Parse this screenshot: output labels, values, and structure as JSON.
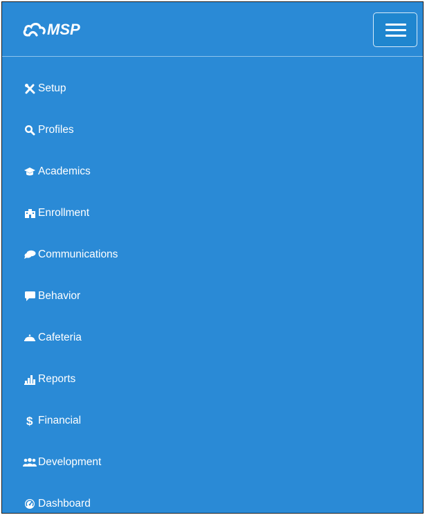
{
  "header": {
    "logo_text": "MSP",
    "menu_toggle_icon": "hamburger-icon"
  },
  "nav": {
    "items": [
      {
        "label": "Setup",
        "icon": "tools-icon"
      },
      {
        "label": "Profiles",
        "icon": "search-icon"
      },
      {
        "label": "Academics",
        "icon": "graduation-cap-icon"
      },
      {
        "label": "Enrollment",
        "icon": "building-icon"
      },
      {
        "label": "Communications",
        "icon": "chat-bubbles-icon"
      },
      {
        "label": "Behavior",
        "icon": "comment-icon"
      },
      {
        "label": "Cafeteria",
        "icon": "dish-cover-icon"
      },
      {
        "label": "Reports",
        "icon": "bar-chart-icon"
      },
      {
        "label": "Financial",
        "icon": "dollar-icon"
      },
      {
        "label": "Development",
        "icon": "users-icon"
      },
      {
        "label": "Dashboard",
        "icon": "dashboard-icon"
      }
    ]
  },
  "colors": {
    "background": "#2a8ad6",
    "text": "#ffffff"
  }
}
